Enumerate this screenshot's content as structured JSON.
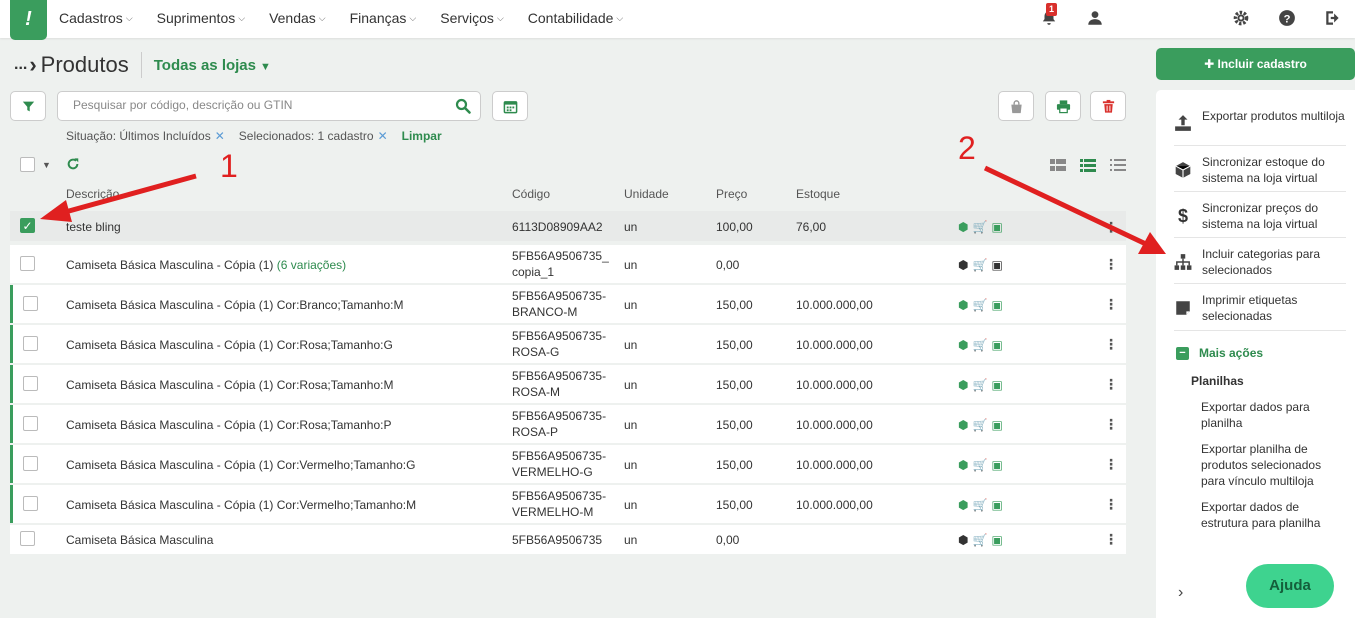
{
  "nav": {
    "logo": "!",
    "menu": [
      "Cadastros",
      "Suprimentos",
      "Vendas",
      "Finanças",
      "Serviços",
      "Contabilidade"
    ],
    "notification_count": "1"
  },
  "header": {
    "breadcrumb_dots": "...",
    "title": "Produtos",
    "store_selector": "Todas as lojas",
    "include_button": "Incluir cadastro"
  },
  "search": {
    "placeholder": "Pesquisar por código, descrição ou GTIN"
  },
  "filters": {
    "situation": "Situação: Últimos Incluídos",
    "selected": "Selecionados: 1 cadastro",
    "clear": "Limpar"
  },
  "table": {
    "columns": [
      "Descrição",
      "Código",
      "Unidade",
      "Preço",
      "Estoque"
    ],
    "rows": [
      {
        "desc": "teste bling",
        "extra": "",
        "code1": "6113D08909AA2",
        "code2": "",
        "unit": "un",
        "price": "100,00",
        "stock": "76,00",
        "checked": true,
        "variation": false
      },
      {
        "desc": "Camiseta Básica Masculina - Cópia (1)",
        "extra": "(6 variações)",
        "code1": "5FB56A9506735_",
        "code2": "copia_1",
        "unit": "un",
        "price": "0,00",
        "stock": "",
        "checked": false,
        "variation": false
      },
      {
        "desc": "Camiseta Básica Masculina - Cópia (1) Cor:Branco;Tamanho:M",
        "extra": "",
        "code1": "5FB56A9506735-",
        "code2": "BRANCO-M",
        "unit": "un",
        "price": "150,00",
        "stock": "10.000.000,00",
        "checked": false,
        "variation": true
      },
      {
        "desc": "Camiseta Básica Masculina - Cópia (1) Cor:Rosa;Tamanho:G",
        "extra": "",
        "code1": "5FB56A9506735-",
        "code2": "ROSA-G",
        "unit": "un",
        "price": "150,00",
        "stock": "10.000.000,00",
        "checked": false,
        "variation": true
      },
      {
        "desc": "Camiseta Básica Masculina - Cópia (1) Cor:Rosa;Tamanho:M",
        "extra": "",
        "code1": "5FB56A9506735-",
        "code2": "ROSA-M",
        "unit": "un",
        "price": "150,00",
        "stock": "10.000.000,00",
        "checked": false,
        "variation": true
      },
      {
        "desc": "Camiseta Básica Masculina - Cópia (1) Cor:Rosa;Tamanho:P",
        "extra": "",
        "code1": "5FB56A9506735-",
        "code2": "ROSA-P",
        "unit": "un",
        "price": "150,00",
        "stock": "10.000.000,00",
        "checked": false,
        "variation": true
      },
      {
        "desc": "Camiseta Básica Masculina - Cópia (1) Cor:Vermelho;Tamanho:G",
        "extra": "",
        "code1": "5FB56A9506735-",
        "code2": "VERMELHO-G",
        "unit": "un",
        "price": "150,00",
        "stock": "10.000.000,00",
        "checked": false,
        "variation": true
      },
      {
        "desc": "Camiseta Básica Masculina - Cópia (1) Cor:Vermelho;Tamanho:M",
        "extra": "",
        "code1": "5FB56A9506735-",
        "code2": "VERMELHO-M",
        "unit": "un",
        "price": "150,00",
        "stock": "10.000.000,00",
        "checked": false,
        "variation": true
      },
      {
        "desc": "Camiseta Básica Masculina",
        "extra": "",
        "code1": "5FB56A9506735",
        "code2": "",
        "unit": "un",
        "price": "0,00",
        "stock": "",
        "checked": false,
        "variation": false
      }
    ]
  },
  "sidebar": {
    "actions": [
      {
        "label": "Exportar produtos multiloja",
        "icon": "upload-icon"
      },
      {
        "label": "Sincronizar estoque do sistema na loja virtual",
        "icon": "box-icon"
      },
      {
        "label": "Sincronizar preços do sistema na loja virtual",
        "icon": "dollar-icon"
      },
      {
        "label": "Incluir categorias para selecionados",
        "icon": "sitemap-icon"
      },
      {
        "label": "Imprimir etiquetas selecionadas",
        "icon": "label-icon"
      }
    ],
    "more_actions": "Mais ações",
    "section": "Planilhas",
    "spreadsheet_items": [
      "Exportar dados para planilha",
      "Exportar planilha de produtos selecionados para vínculo multiloja",
      "Exportar dados de estrutura para planilha"
    ]
  },
  "help_button": "Ajuda",
  "annotations": [
    "1",
    "2"
  ],
  "colors": {
    "brand": "#3a9d5d",
    "annotation": "#e02020",
    "help": "#3ed38f"
  }
}
